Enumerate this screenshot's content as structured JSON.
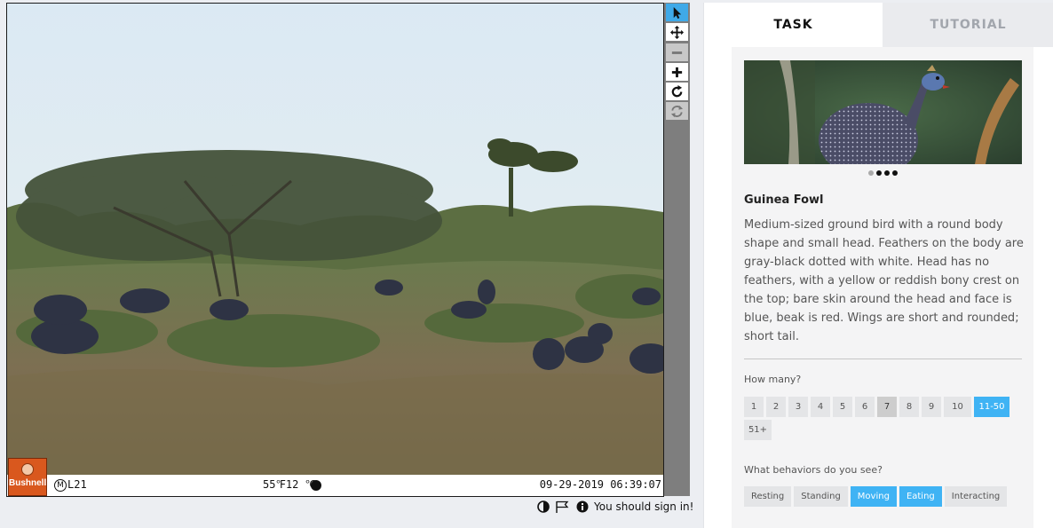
{
  "colors": {
    "accent": "#3fb3f4",
    "toolbar": "#7e7e7e",
    "bushnell_orange": "#d9581e"
  },
  "viewer": {
    "camera_id": "L21",
    "moon_icon_letter": "M",
    "temps": "55℉12 ℃",
    "datetime": "09-29-2019 06:39:07",
    "logo_text": "Bushnell",
    "tools": [
      {
        "icon": "pointer-icon",
        "state": "active"
      },
      {
        "icon": "move-icon",
        "state": "normal"
      },
      {
        "icon": "zoom-out-icon",
        "state": "disabled"
      },
      {
        "icon": "zoom-in-icon",
        "state": "normal"
      },
      {
        "icon": "rotate-icon",
        "state": "normal"
      },
      {
        "icon": "reset-icon",
        "state": "disabled"
      }
    ]
  },
  "footer": {
    "icons": [
      "contrast-icon",
      "flag-icon",
      "info-icon"
    ],
    "signin_text": "You should sign in!"
  },
  "tabs": {
    "task": "TASK",
    "tutorial": "TUTORIAL"
  },
  "species": {
    "name": "Guinea Fowl",
    "description": "Medium-sized ground bird with a round body shape and small head. Feathers on the body are gray-black dotted with white. Head has no feathers, with a yellow or reddish bony crest on the top; bare skin around the head and face is blue, beak is red. Wings are short and rounded; short tail.",
    "carousel": {
      "count": 4,
      "active": 0
    }
  },
  "questions": {
    "how_many": {
      "label": "How many?",
      "options": [
        "1",
        "2",
        "3",
        "4",
        "5",
        "6",
        "7",
        "8",
        "9",
        "10",
        "11-50",
        "51+"
      ],
      "selected": "11-50",
      "highlighted": "7"
    },
    "behaviors": {
      "label": "What behaviors do you see?",
      "options": [
        "Resting",
        "Standing",
        "Moving",
        "Eating",
        "Interacting"
      ],
      "selected": [
        "Moving",
        "Eating"
      ]
    }
  }
}
